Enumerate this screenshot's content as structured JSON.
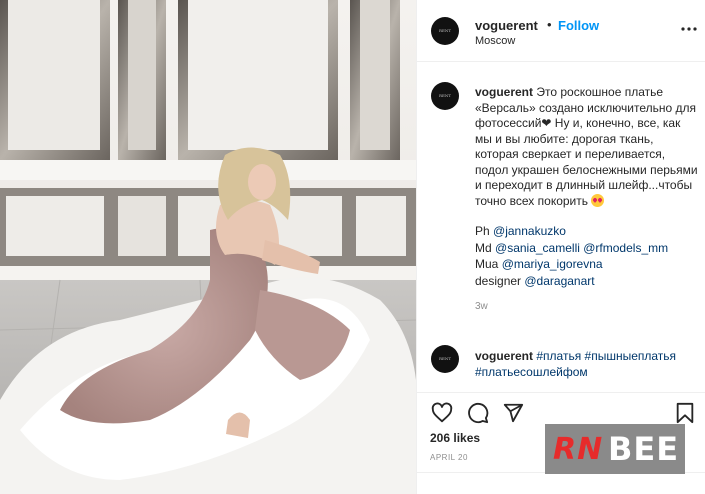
{
  "header": {
    "username": "voguerent",
    "separator": "•",
    "follow_label": "Follow",
    "location": "Moscow",
    "avatar_text": "RENT SERVICE"
  },
  "caption": {
    "username": "voguerent",
    "text": "Это роскошное платье «Версаль» создано исключительно для фотосессий❤ Ну и, конечно, все, как мы и вы любите: дорогая ткань, которая сверкает и переливается, подол украшен белоснежными перьями и переходит в длинный шлейф...чтобы точно всех покорить",
    "emoji": "heart-eyes",
    "credits": [
      {
        "role": "Ph",
        "handles": [
          "@jannakuzko"
        ]
      },
      {
        "role": "Md",
        "handles": [
          "@sania_camelli",
          "@rfmodels_mm"
        ]
      },
      {
        "role": "Mua",
        "handles": [
          "@mariya_igorevna"
        ]
      },
      {
        "role": "designer",
        "handles": [
          "@daraganart"
        ]
      }
    ],
    "time_ago": "3w"
  },
  "second_comment": {
    "username": "voguerent",
    "hashtags": "#платья #пышныеплатья #платьесошлейфом"
  },
  "actions": {
    "like_icon": "heart-icon",
    "comment_icon": "comment-icon",
    "share_icon": "share-icon",
    "save_icon": "bookmark-icon"
  },
  "likes": "206 likes",
  "date": "APRIL 20",
  "watermark": {
    "left": "RN",
    "right": "BEE"
  },
  "colors": {
    "accent": "#0095f6",
    "link": "#00376b",
    "muted": "#8e8e8e"
  }
}
